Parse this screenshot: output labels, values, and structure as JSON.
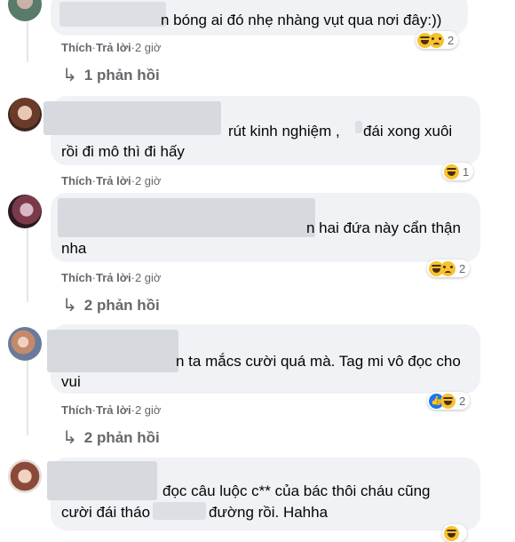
{
  "actions": {
    "like": "Thích",
    "reply": "Trả lời",
    "sep": " · ",
    "time": "2 giờ"
  },
  "comments": [
    {
      "text_lines": [
        "n bóng ai đó nhẹ nhàng vụt qua nơi đây:))"
      ],
      "reaction_count": "2",
      "replies": "1 phản hồi",
      "reaction_icons": [
        "haha-icon",
        "sad-icon"
      ]
    },
    {
      "text_lines": [
        "rút kinh nghiệm ,",
        "đái xong xuôi",
        "rồi đi mô thì đi hấy"
      ],
      "reaction_count": "1",
      "replies": "",
      "reaction_icons": [
        "haha-icon"
      ]
    },
    {
      "text_lines": [
        "n hai đứa này cẩn thận",
        "nha"
      ],
      "reaction_count": "2",
      "replies": "2 phản hồi",
      "reaction_icons": [
        "haha-icon",
        "sad-icon"
      ]
    },
    {
      "text_lines": [
        "n ta mắcs cười quá mà. Tag mi vô đọc cho",
        "vui"
      ],
      "reaction_count": "2",
      "replies": "2 phản hồi",
      "reaction_icons": [
        "like-icon",
        "haha-icon"
      ]
    },
    {
      "text_lines": [
        "đọc câu luộc c** của bác thôi cháu cũng",
        "cười đái tháo",
        "đường rồi. Hahha"
      ],
      "reaction_count": "",
      "replies": "",
      "reaction_icons": [
        "haha-icon"
      ]
    }
  ],
  "colors": {
    "bubble": "#f0f2f5",
    "meta": "#65676b",
    "text": "#050505"
  }
}
